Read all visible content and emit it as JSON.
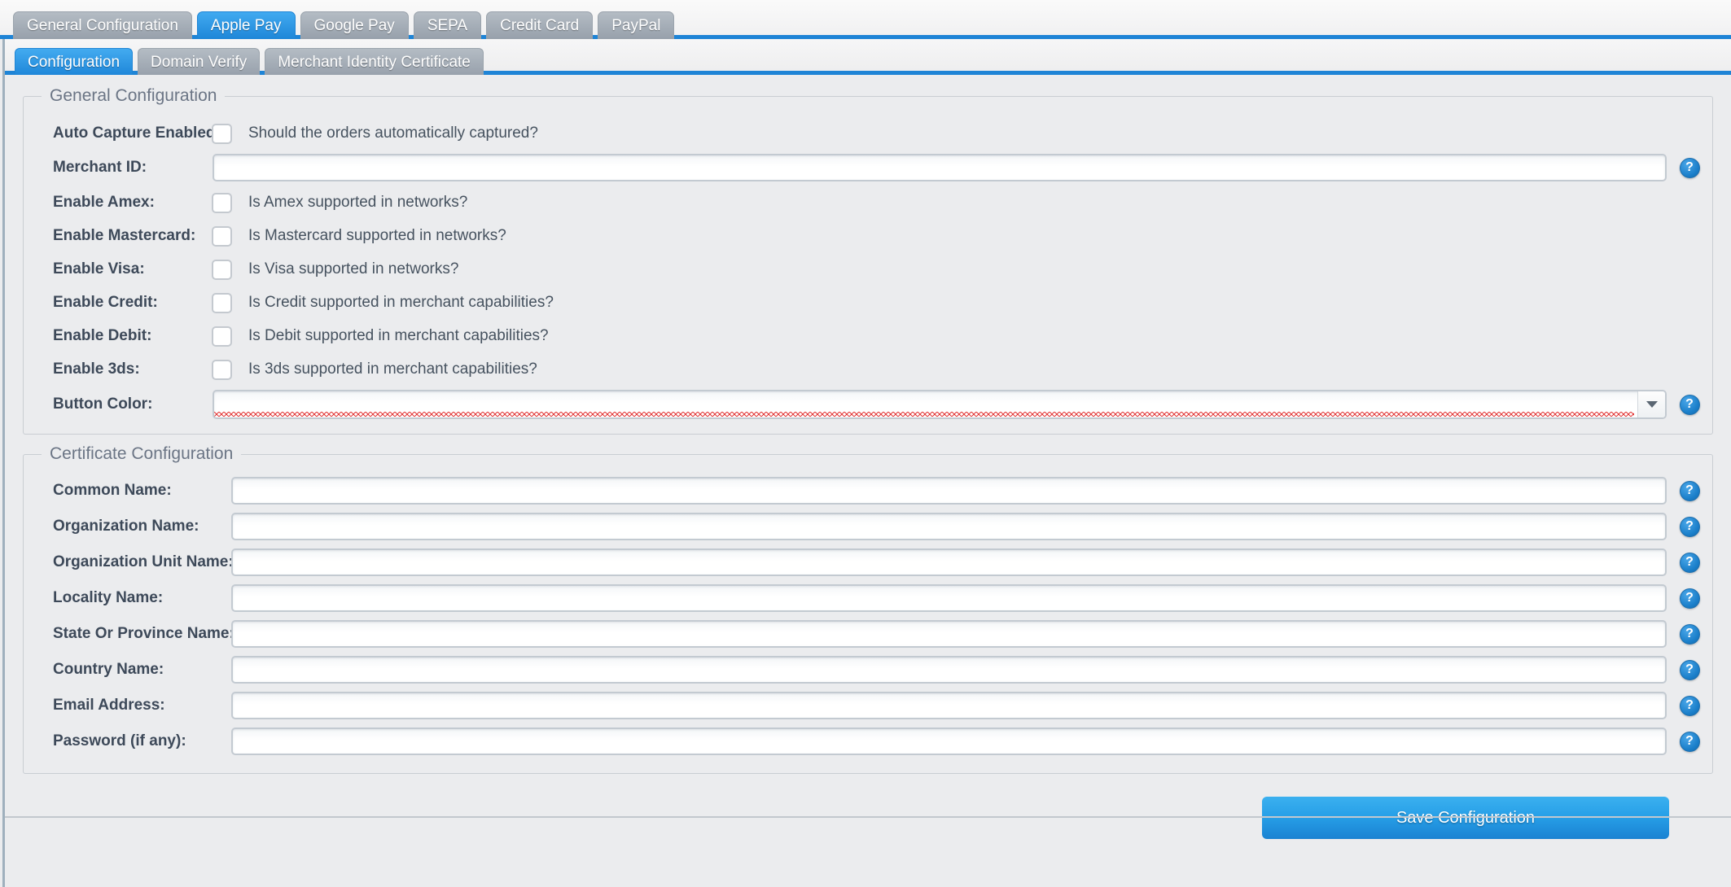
{
  "outer_tabs": [
    {
      "label": "General Configuration",
      "active": false
    },
    {
      "label": "Apple Pay",
      "active": true
    },
    {
      "label": "Google Pay",
      "active": false
    },
    {
      "label": "SEPA",
      "active": false
    },
    {
      "label": "Credit Card",
      "active": false
    },
    {
      "label": "PayPal",
      "active": false
    }
  ],
  "inner_tabs": [
    {
      "label": "Configuration",
      "active": true
    },
    {
      "label": "Domain Verify",
      "active": false
    },
    {
      "label": "Merchant Identity Certificate",
      "active": false
    }
  ],
  "general_section": {
    "legend": "General Configuration",
    "rows": [
      {
        "type": "checkbox",
        "label": "Auto Capture Enabled:",
        "hint": "Should the orders automatically captured?",
        "checked": false,
        "help": false
      },
      {
        "type": "text",
        "label": "Merchant ID:",
        "value": "",
        "placeholder": "",
        "help": true
      },
      {
        "type": "checkbox",
        "label": "Enable Amex:",
        "hint": "Is Amex supported in networks?",
        "checked": false,
        "help": false
      },
      {
        "type": "checkbox",
        "label": "Enable Mastercard:",
        "hint": "Is Mastercard supported in networks?",
        "checked": false,
        "help": false
      },
      {
        "type": "checkbox",
        "label": "Enable Visa:",
        "hint": "Is Visa supported in networks?",
        "checked": false,
        "help": false
      },
      {
        "type": "checkbox",
        "label": "Enable Credit:",
        "hint": "Is Credit supported in merchant capabilities?",
        "checked": false,
        "help": false
      },
      {
        "type": "checkbox",
        "label": "Enable Debit:",
        "hint": "Is Debit supported in merchant capabilities?",
        "checked": false,
        "help": false
      },
      {
        "type": "checkbox",
        "label": "Enable 3ds:",
        "hint": "Is 3ds supported in merchant capabilities?",
        "checked": false,
        "help": false
      },
      {
        "type": "select",
        "label": "Button Color:",
        "value": "",
        "error": true,
        "help": true
      }
    ]
  },
  "certificate_section": {
    "legend": "Certificate Configuration",
    "rows": [
      {
        "label": "Common Name:",
        "value": "",
        "help": true
      },
      {
        "label": "Organization Name:",
        "value": "",
        "help": true
      },
      {
        "label": "Organization Unit Name:",
        "value": "",
        "help": true
      },
      {
        "label": "Locality Name:",
        "value": "",
        "help": true
      },
      {
        "label": "State Or Province Name:",
        "value": "",
        "help": true
      },
      {
        "label": "Country Name:",
        "value": "",
        "help": true
      },
      {
        "label": "Email Address:",
        "value": "",
        "help": true
      },
      {
        "label": "Password (if any):",
        "value": "",
        "help": true
      }
    ]
  },
  "save_button": {
    "label": "Save Configuration"
  },
  "icons": {
    "help": "?",
    "dropdown": "chevron-down-icon"
  },
  "colors": {
    "accent_blue": "#1e84d6",
    "tab_inactive": "#98a1ac",
    "error_red": "#e23b3b",
    "page_bg": "#ebecee"
  }
}
